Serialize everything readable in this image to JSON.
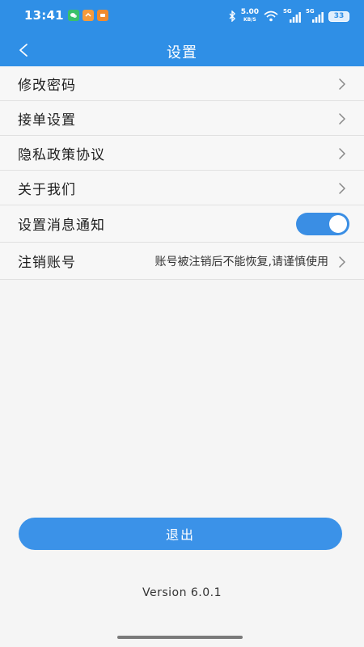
{
  "status_bar": {
    "time": "13:41",
    "net_speed": "5.00",
    "net_speed_unit": "KB/S",
    "sim1_tag": "5G",
    "sim2_tag": "5G",
    "battery": "33"
  },
  "header": {
    "title": "设置"
  },
  "settings": {
    "items": [
      {
        "label": "修改密码"
      },
      {
        "label": "接单设置"
      },
      {
        "label": "隐私政策协议"
      },
      {
        "label": "关于我们"
      },
      {
        "label": "设置消息通知",
        "toggle_on": true
      },
      {
        "label": "注销账号",
        "sub": "账号被注销后不能恢复,请谨慎使用"
      }
    ]
  },
  "logout": {
    "label": "退出"
  },
  "version": "Version  6.0.1",
  "colors": {
    "primary": "#2f8fe6",
    "button": "#3b92e8"
  }
}
